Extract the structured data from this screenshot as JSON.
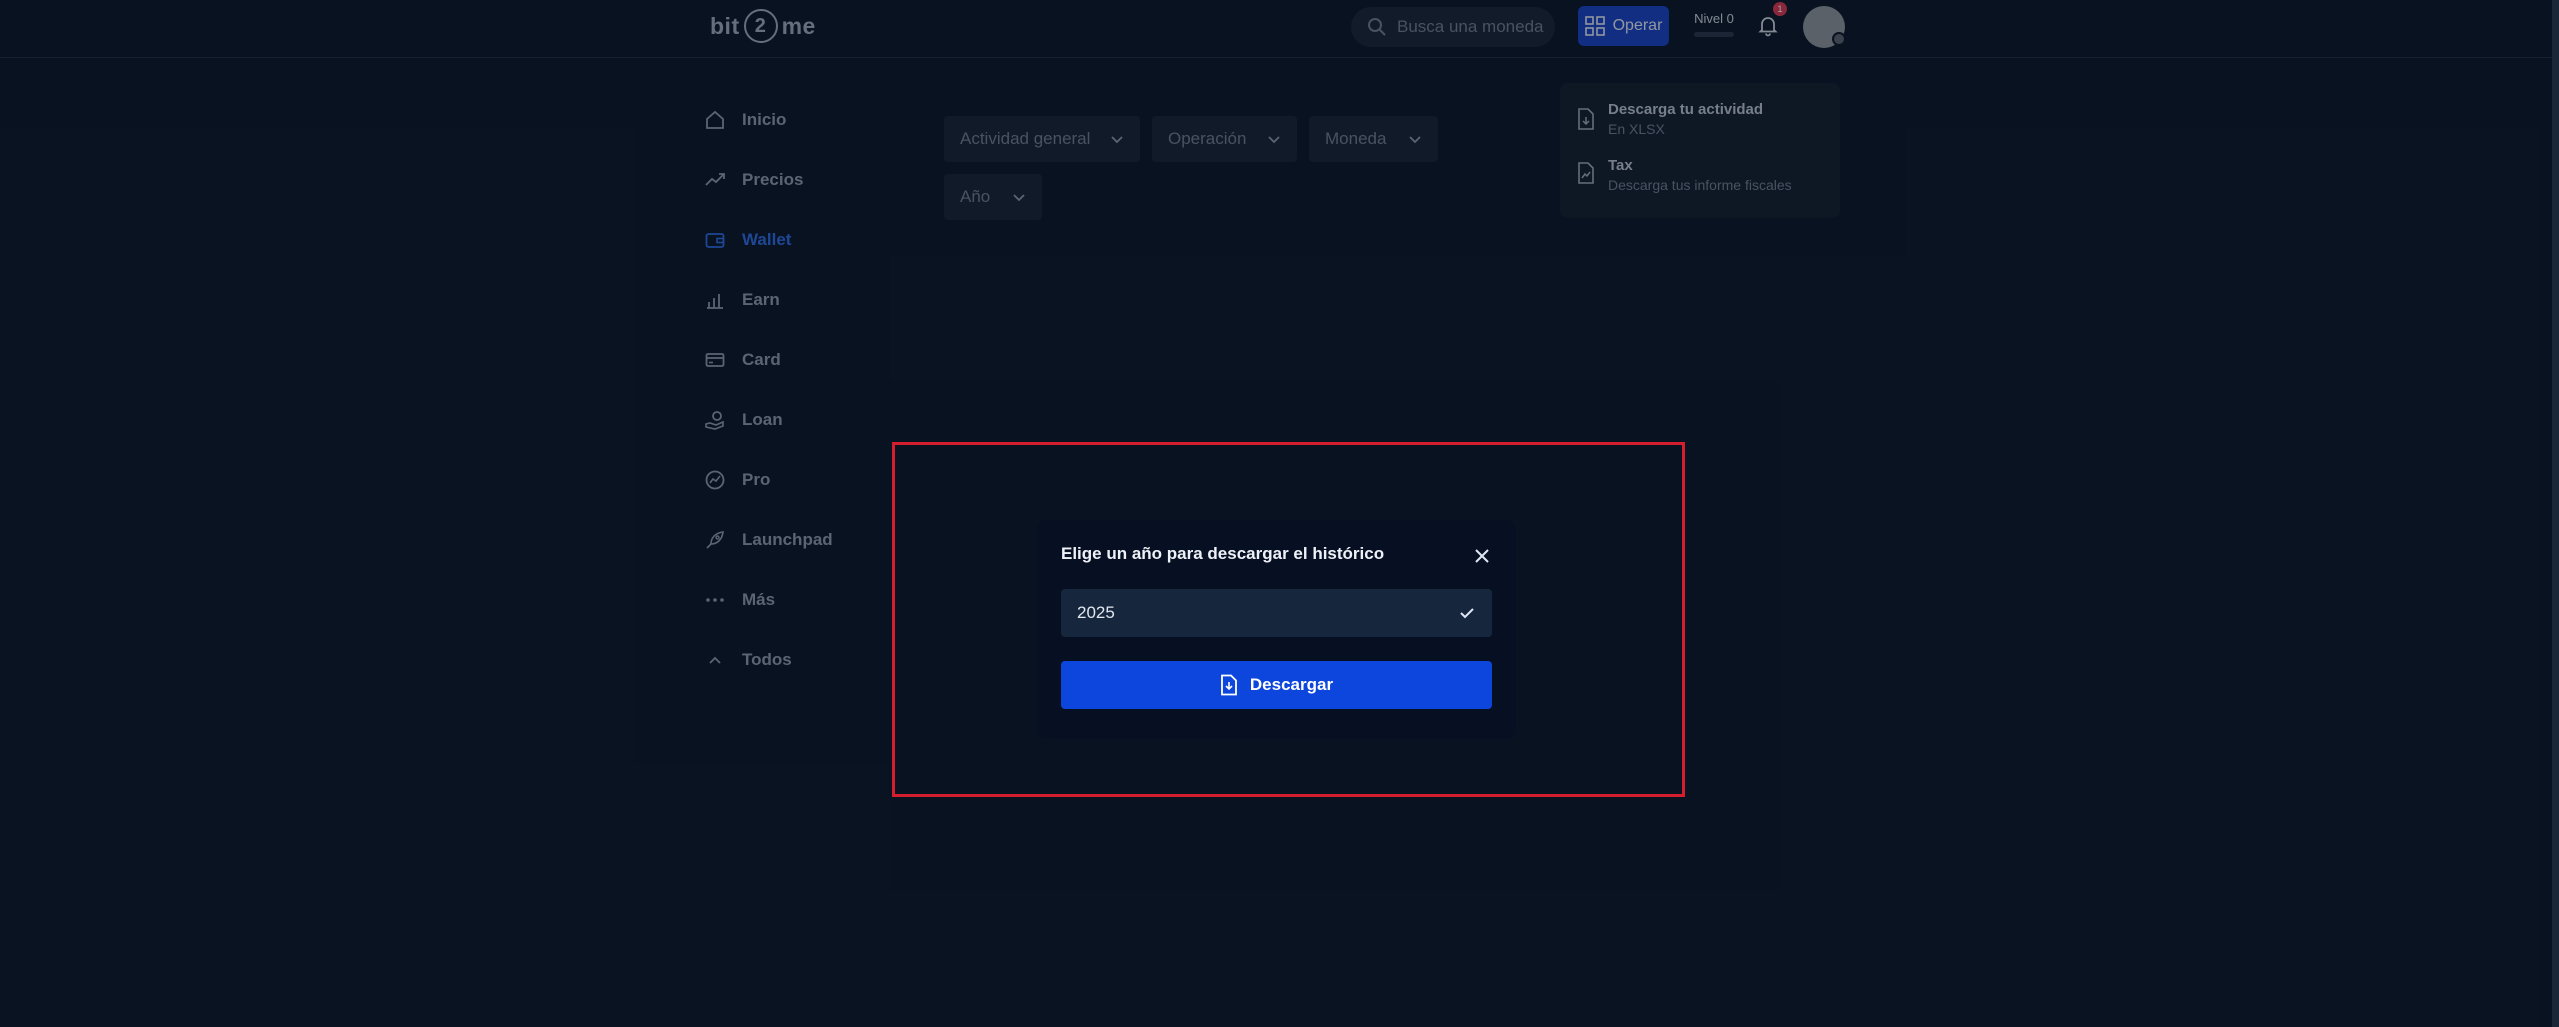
{
  "header": {
    "logo_left": "bit",
    "logo_mid": "2",
    "logo_right": "me",
    "search_placeholder": "Busca una moneda",
    "operar_label": "Operar",
    "level_label": "Nivel 0",
    "notification_count": "1"
  },
  "sidebar": {
    "items": [
      {
        "label": "Inicio",
        "icon": "home-icon"
      },
      {
        "label": "Precios",
        "icon": "trend-icon"
      },
      {
        "label": "Wallet",
        "icon": "wallet-icon",
        "active": true
      },
      {
        "label": "Earn",
        "icon": "earn-icon"
      },
      {
        "label": "Card",
        "icon": "card-icon"
      },
      {
        "label": "Loan",
        "icon": "loan-icon"
      },
      {
        "label": "Pro",
        "icon": "pro-icon"
      },
      {
        "label": "Launchpad",
        "icon": "rocket-icon"
      },
      {
        "label": "Más",
        "icon": "more-icon"
      },
      {
        "label": "Todos",
        "icon": "chevron-up-icon"
      }
    ]
  },
  "filters": {
    "activity": "Actividad general",
    "operation": "Operación",
    "currency": "Moneda",
    "year": "Año"
  },
  "panel": {
    "download_title": "Descarga tu actividad",
    "download_sub": "En XLSX",
    "tax_title": "Tax",
    "tax_sub": "Descarga tus informe fiscales"
  },
  "modal": {
    "title": "Elige un año para descargar el histórico",
    "selected_year": "2025",
    "download_label": "Descargar"
  },
  "colors": {
    "background": "#0f1d33",
    "accent": "#0c46dd",
    "active_nav": "#2f6ee6",
    "highlight": "#d41e2e"
  }
}
